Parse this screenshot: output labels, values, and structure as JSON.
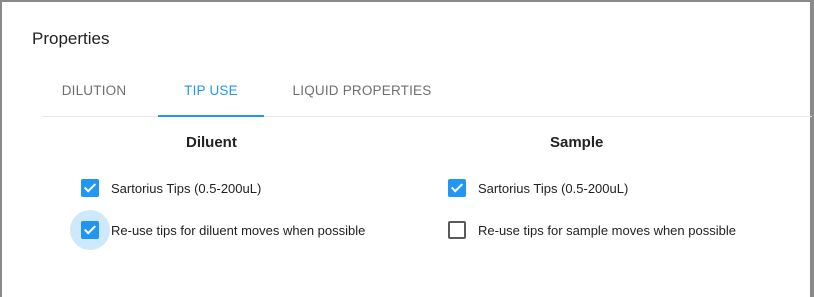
{
  "panel": {
    "title": "Properties"
  },
  "tabs": [
    {
      "label": "DILUTION",
      "active": false
    },
    {
      "label": "TIP USE",
      "active": true
    },
    {
      "label": "LIQUID PROPERTIES",
      "active": false
    }
  ],
  "columns": {
    "diluent": {
      "heading": "Diluent",
      "options": [
        {
          "label": "Sartorius Tips (0.5-200uL)",
          "checked": true
        },
        {
          "label": "Re-use tips for diluent moves when possible",
          "checked": true,
          "focused": true
        }
      ]
    },
    "sample": {
      "heading": "Sample",
      "options": [
        {
          "label": "Sartorius Tips (0.5-200uL)",
          "checked": true
        },
        {
          "label": "Re-use tips for sample moves when possible",
          "checked": false
        }
      ]
    }
  },
  "colors": {
    "accent": "#2196f3",
    "text": "#222222",
    "tab_inactive": "#6f6f6f",
    "frame_border": "#8a8a8a"
  }
}
